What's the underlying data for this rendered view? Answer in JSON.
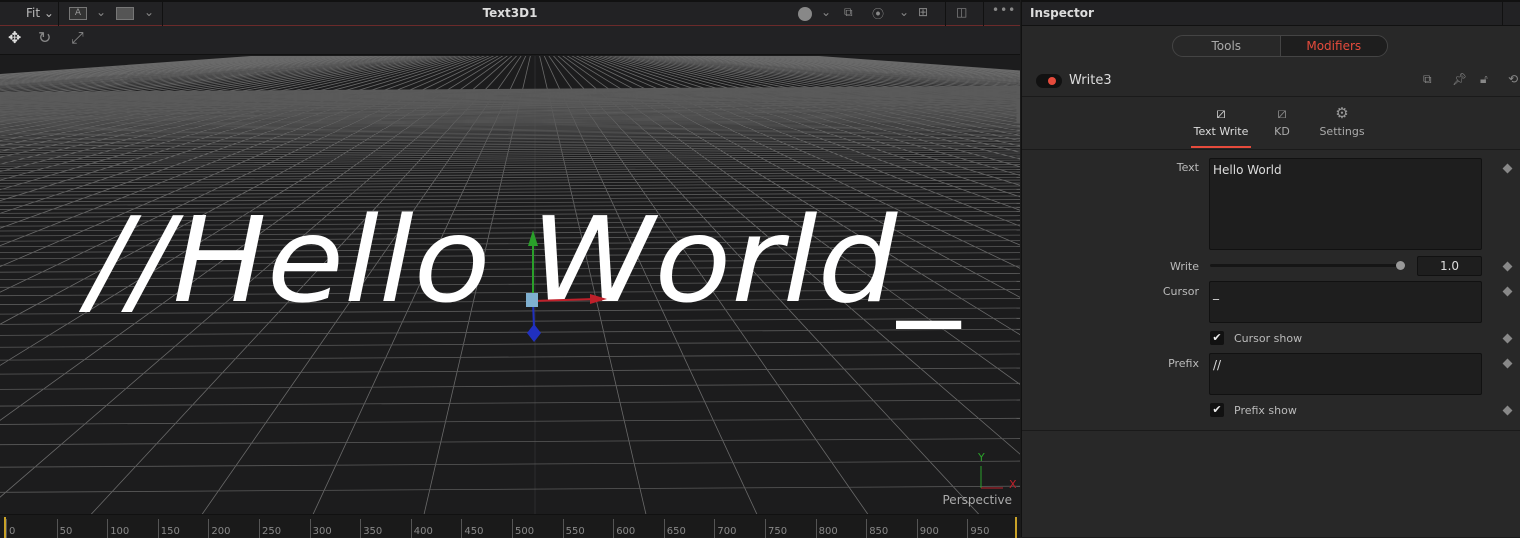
{
  "viewer": {
    "fit_label": "Fit",
    "title": "Text3D1",
    "text3d": "//Hello World_",
    "view_label": "Perspective",
    "axis_x": "X",
    "axis_y": "Y",
    "ruler_ticks": [
      "0",
      "50",
      "100",
      "150",
      "200",
      "250",
      "300",
      "350",
      "400",
      "450",
      "500",
      "550",
      "600",
      "650",
      "700",
      "750",
      "800",
      "850",
      "900",
      "950"
    ]
  },
  "inspector": {
    "title": "Inspector",
    "tabs": [
      "Tools",
      "Modifiers"
    ],
    "active_tab": "Modifiers",
    "node_name": "Write3",
    "subtabs": [
      {
        "label": "Text Write",
        "icon": "text-write-icon"
      },
      {
        "label": "KD",
        "icon": "kd-icon"
      },
      {
        "label": "Settings",
        "icon": "settings-icon"
      }
    ],
    "fields": {
      "text_label": "Text",
      "text_value": "Hello World",
      "write_label": "Write",
      "write_value": "1.0",
      "cursor_label": "Cursor",
      "cursor_value": "_",
      "cursor_show_label": "Cursor show",
      "cursor_show": true,
      "prefix_label": "Prefix",
      "prefix_value": "//",
      "prefix_show_label": "Prefix show",
      "prefix_show": true
    }
  },
  "colors": {
    "accent": "#e64b3c",
    "axis_x": "#c0202a",
    "axis_y": "#2aa02a",
    "axis_z": "#2030c0"
  }
}
